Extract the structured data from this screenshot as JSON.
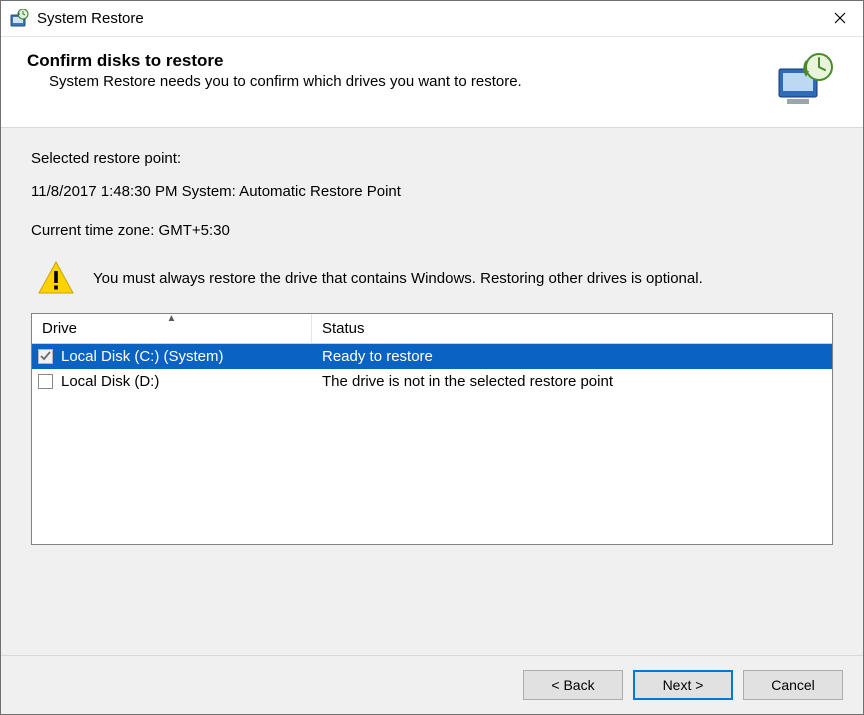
{
  "window": {
    "title": "System Restore"
  },
  "header": {
    "heading": "Confirm disks to restore",
    "sub": "System Restore needs you to confirm which drives you want to restore."
  },
  "body": {
    "selected_label": "Selected restore point:",
    "selected_value": "11/8/2017 1:48:30 PM System: Automatic Restore Point",
    "timezone": "Current time zone: GMT+5:30",
    "warning": "You must always restore the drive that contains Windows. Restoring other drives is optional."
  },
  "table": {
    "headers": {
      "drive": "Drive",
      "status": "Status"
    },
    "rows": [
      {
        "checked": true,
        "disabled": true,
        "selected": true,
        "drive": "Local Disk (C:) (System)",
        "status": "Ready to restore"
      },
      {
        "checked": false,
        "disabled": false,
        "selected": false,
        "drive": "Local Disk (D:)",
        "status": "The drive is not in the selected restore point"
      }
    ]
  },
  "footer": {
    "back": "< Back",
    "next": "Next >",
    "cancel": "Cancel"
  }
}
